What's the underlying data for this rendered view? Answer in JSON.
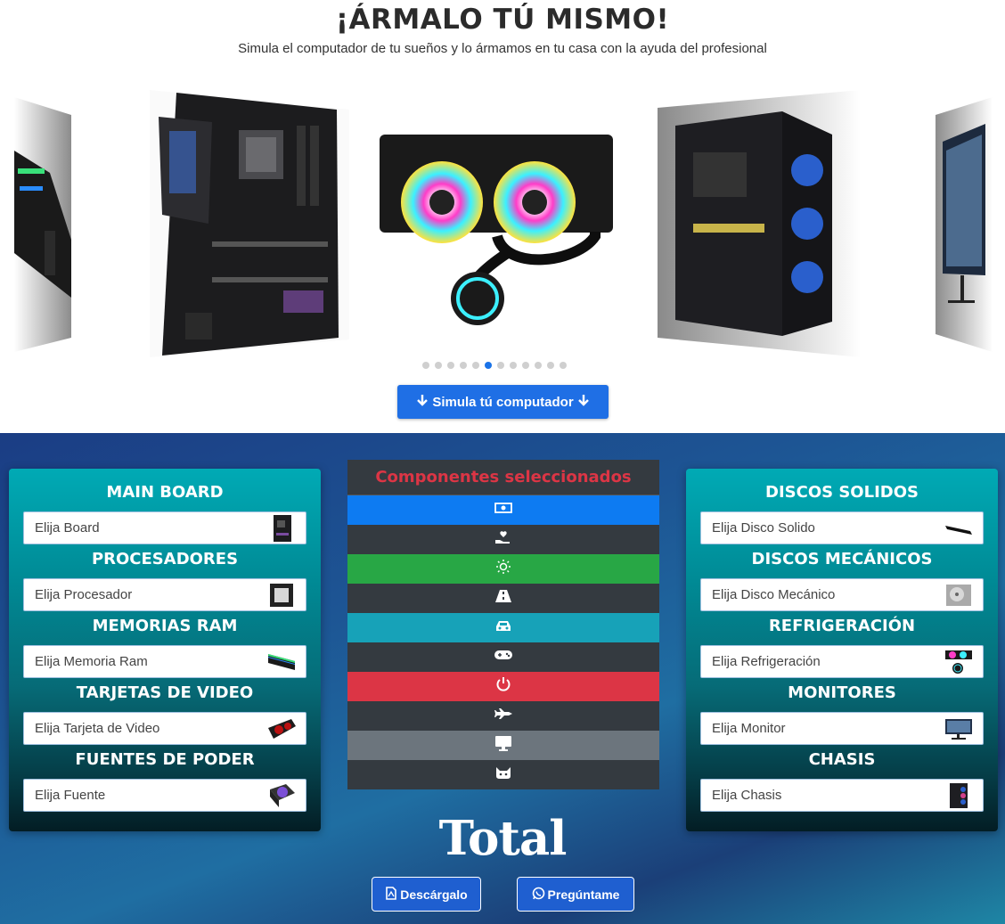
{
  "hero": {
    "title": "¡ÁRMALO TÚ MISMO!",
    "subtitle": "Simula el computador de tu sueños y lo ármamos en tu casa con la ayuda del profesional",
    "cta_label": "Simula tú computador",
    "carousel_dots": 12,
    "carousel_active_index": 5
  },
  "left_panel": {
    "sections": [
      {
        "title": "MAIN BOARD",
        "placeholder": "Elija Board",
        "thumb": "motherboard-icon"
      },
      {
        "title": "PROCESADORES",
        "placeholder": "Elija Procesador",
        "thumb": "cpu-icon"
      },
      {
        "title": "MEMORIAS RAM",
        "placeholder": "Elija Memoria Ram",
        "thumb": "ram-icon"
      },
      {
        "title": "TARJETAS DE VIDEO",
        "placeholder": "Elija Tarjeta de Video",
        "thumb": "gpu-icon"
      },
      {
        "title": "FUENTES DE PODER",
        "placeholder": "Elija Fuente",
        "thumb": "psu-icon"
      }
    ]
  },
  "right_panel": {
    "sections": [
      {
        "title": "DISCOS SOLIDOS",
        "placeholder": "Elija Disco Solido",
        "thumb": "ssd-icon"
      },
      {
        "title": "DISCOS MECÁNICOS",
        "placeholder": "Elija Disco Mecánico",
        "thumb": "hdd-icon"
      },
      {
        "title": "REFRIGERACIÓN",
        "placeholder": "Elija Refrigeración",
        "thumb": "cooler-icon"
      },
      {
        "title": "MONITORES",
        "placeholder": "Elija Monitor",
        "thumb": "monitor-icon"
      },
      {
        "title": "CHASIS",
        "placeholder": "Elija Chasis",
        "thumb": "case-icon"
      }
    ]
  },
  "components": {
    "title": "Componentes seleccionados",
    "rows": [
      {
        "icon": "money-bill-icon",
        "color": "#0d7bf2"
      },
      {
        "icon": "hand-holding-heart-icon",
        "color": "#343a40"
      },
      {
        "icon": "sun-icon",
        "color": "#28a745"
      },
      {
        "icon": "road-icon",
        "color": "#343a40"
      },
      {
        "icon": "car-icon",
        "color": "#17a2b8"
      },
      {
        "icon": "gamepad-icon",
        "color": "#343a40"
      },
      {
        "icon": "power-icon",
        "color": "#dc3545"
      },
      {
        "icon": "plane-icon",
        "color": "#343a40"
      },
      {
        "icon": "desktop-icon",
        "color": "#6c757d"
      },
      {
        "icon": "cat-icon",
        "color": "#343a40"
      }
    ]
  },
  "total_label": "Total",
  "actions": {
    "download_label": "Descárgalo",
    "ask_label": "Pregúntame"
  },
  "colors": {
    "accent": "#1f6fe5",
    "title_red": "#dc3545",
    "panel_teal": "#00aab5"
  }
}
